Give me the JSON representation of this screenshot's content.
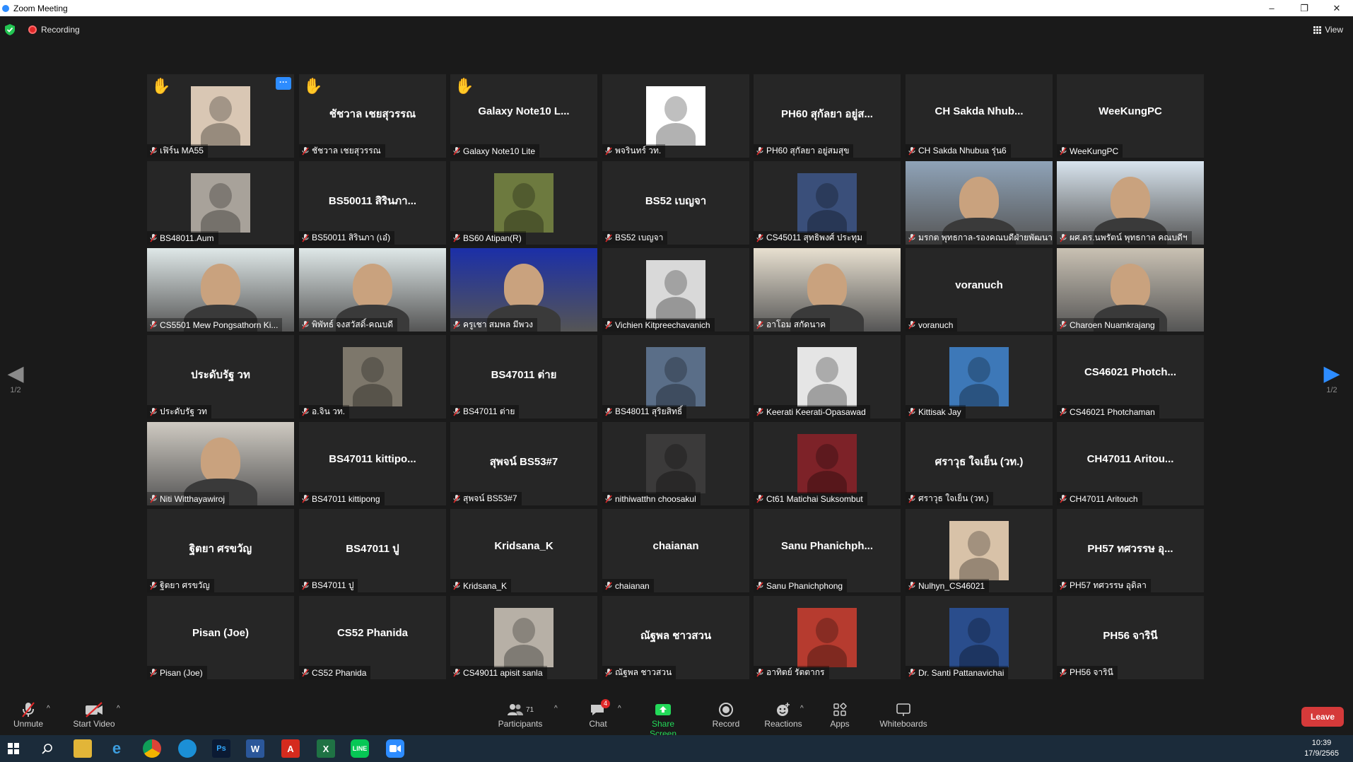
{
  "window": {
    "title": "Zoom Meeting",
    "controls": [
      "–",
      "❐",
      "✕"
    ]
  },
  "topbar": {
    "recording_label": "Recording",
    "view_label": "View"
  },
  "pager": {
    "left": "1/2",
    "right": "1/2"
  },
  "tiles": [
    {
      "label": "เฟิร์น MA55",
      "kind": "avatar",
      "color": "#d9c7b4",
      "hand": true,
      "more": true
    },
    {
      "label": "ชัชวาล  เชยสุวรรณ",
      "center": "ชัชวาล  เชยสุวรรณ",
      "hand": true
    },
    {
      "label": "Galaxy Note10 Lite",
      "center": "Galaxy Note10 L...",
      "hand": true
    },
    {
      "label": "พจรินทร์ วท.",
      "kind": "avatar",
      "color": "#ffffff"
    },
    {
      "label": "PH60 สุกัลยา อยู่สมสุข",
      "center": "PH60 สุกัลยา อยู่ส..."
    },
    {
      "label": "CH Sakda Nhubua รุ่น6",
      "center": "CH Sakda Nhub..."
    },
    {
      "label": "WeeKungPC",
      "center": "WeeKungPC"
    },
    {
      "label": "BS48011.Aum",
      "kind": "avatar",
      "color": "#a8a29a"
    },
    {
      "label": "BS50011 สิรินภา (เอ๋)",
      "center": "BS50011 สิรินภา..."
    },
    {
      "label": "BS60 Atipan(R)",
      "kind": "avatar",
      "color": "#6d7a3f"
    },
    {
      "label": "BS52 เบญจา",
      "center": "BS52 เบญจา"
    },
    {
      "label": "CS45011 สุทธิพงศ์ ประทุม",
      "kind": "avatar",
      "color": "#3a4f7a"
    },
    {
      "label": "มรกต พุทธกาล-รองคณบดีฝ่ายพัฒนา...",
      "kind": "video",
      "color": "#8fa3b8"
    },
    {
      "label": "ผศ.ดร.นพรัตน์ พุทธกาล คณบดีฯ",
      "kind": "video",
      "color": "#d8e4ee"
    },
    {
      "label": "CS5501 Mew Pongsathorn Ki...",
      "kind": "video",
      "color": "#dfe8e8"
    },
    {
      "label": "พิพัทธ์ จงสวัสดิ์-คณบดี",
      "kind": "video",
      "color": "#dfe8e8"
    },
    {
      "label": "ครูเชา สมพล มีพวง",
      "kind": "video",
      "color": "#1b2fa8"
    },
    {
      "label": "Vichien Kitpreechavanich",
      "kind": "avatar",
      "color": "#d9d9d9"
    },
    {
      "label": "อาโอม สกัดนาค",
      "kind": "video",
      "color": "#e8e0d0",
      "active": true
    },
    {
      "label": "voranuch",
      "center": "voranuch"
    },
    {
      "label": "Charoen Nuamkrajang",
      "kind": "video",
      "color": "#c9c1b3"
    },
    {
      "label": "ประดับรัฐ วท",
      "center": "ประดับรัฐ วท"
    },
    {
      "label": "อ.จิน วท.",
      "kind": "avatar",
      "color": "#7d776b"
    },
    {
      "label": "BS47011 ต่าย",
      "center": "BS47011 ต่าย"
    },
    {
      "label": "BS48011 สุริยสิทธิ์",
      "kind": "avatar",
      "color": "#5a6e88"
    },
    {
      "label": "Keerati Keerati-Opasawad",
      "kind": "avatar",
      "color": "#e5e5e5"
    },
    {
      "label": "Kittisak Jay",
      "kind": "avatar",
      "color": "#3d78b8"
    },
    {
      "label": "CS46021 Photchaman",
      "center": "CS46021 Photch..."
    },
    {
      "label": "Niti Witthayawiroj",
      "kind": "video",
      "color": "#cfcac2"
    },
    {
      "label": "BS47011 kittipong",
      "center": "BS47011 kittipo..."
    },
    {
      "label": "สุพจน์ BS53#7",
      "center": "สุพจน์ BS53#7"
    },
    {
      "label": "nithiwatthn choosakul",
      "kind": "avatar",
      "color": "#3b3a3a"
    },
    {
      "label": "Ct61 Matichai Suksombut",
      "kind": "avatar",
      "color": "#7d2228"
    },
    {
      "label": "ศราวุธ ใจเย็น (วท.)",
      "center": "ศราวุธ ใจเย็น (วท.)"
    },
    {
      "label": "CH47011 Aritouch",
      "center": "CH47011 Aritou..."
    },
    {
      "label": "ฐิตยา  ศรขวัญ",
      "center": "ฐิตยา  ศรขวัญ"
    },
    {
      "label": "BS47011 ปู",
      "center": "BS47011 ปู"
    },
    {
      "label": "Kridsana_K",
      "center": "Kridsana_K"
    },
    {
      "label": "chaianan",
      "center": "chaianan"
    },
    {
      "label": "Sanu Phanichphong",
      "center": "Sanu  Phanichph..."
    },
    {
      "label": "Nulhyn_CS46021",
      "kind": "avatar",
      "color": "#d8c2a8"
    },
    {
      "label": "PH57 ทศวรรษ อุดิลา",
      "center": "PH57 ทศวรรษ อุ..."
    },
    {
      "label": "Pisan (Joe)",
      "center": "Pisan (Joe)"
    },
    {
      "label": "CS52 Phanida",
      "center": "CS52 Phanida"
    },
    {
      "label": "CS49011 apisit sanla",
      "kind": "avatar",
      "color": "#b7b0a6"
    },
    {
      "label": "ณัฐพล ชาวสวน",
      "center": "ณัฐพล ชาวสวน"
    },
    {
      "label": "อาทิตย์ รัตตากร",
      "kind": "avatar",
      "color": "#b63b2f"
    },
    {
      "label": "Dr. Santi Pattanavichai",
      "kind": "avatar",
      "color": "#2a4d8c"
    },
    {
      "label": "PH56 จารินี",
      "center": "PH56 จารินี"
    }
  ],
  "toolbar": {
    "unmute": "Unmute",
    "start_video": "Start Video",
    "participants": "Participants",
    "participants_count": "71",
    "chat": "Chat",
    "chat_badge": "4",
    "share_screen": "Share Screen",
    "record": "Record",
    "reactions": "Reactions",
    "apps": "Apps",
    "whiteboards": "Whiteboards",
    "leave": "Leave"
  },
  "taskbar": {
    "time": "10:39",
    "date": "17/9/2565"
  },
  "colors": {
    "accent": "#2d8cff",
    "leave": "#d53a3a",
    "active_speaker": "#f7e348",
    "share_green": "#23d959"
  }
}
